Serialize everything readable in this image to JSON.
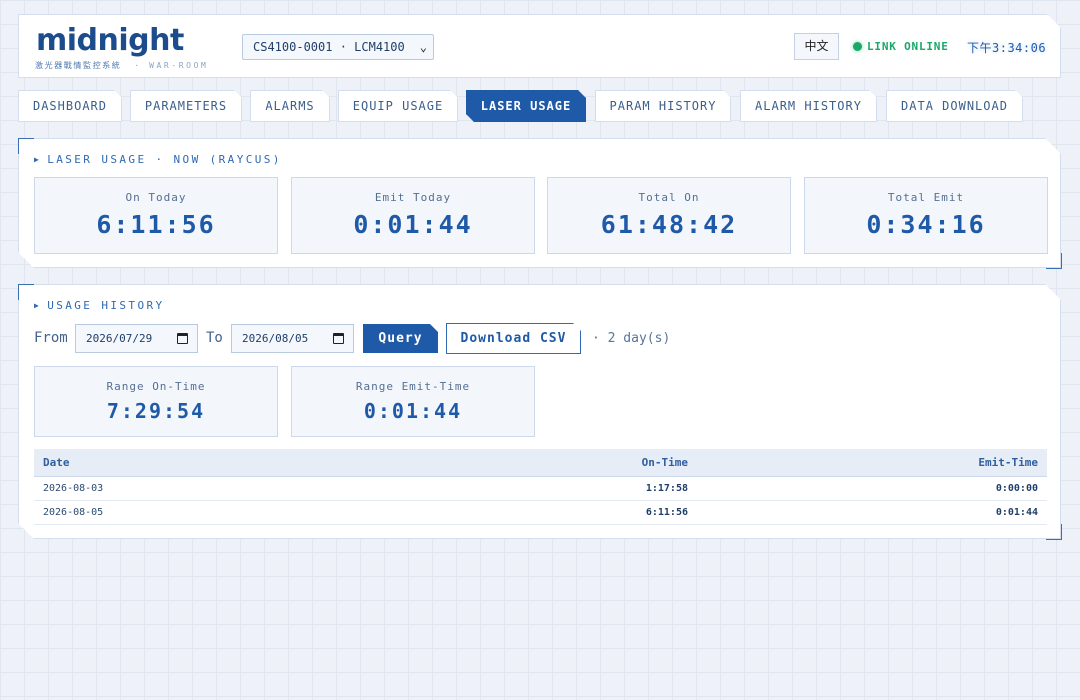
{
  "header": {
    "logo": "midnight",
    "subtitle": "激光器戰情監控系統",
    "subtitle_tag": "· WAR-ROOM",
    "device_select": "CS4100-0001 · LCM4100",
    "lang_button": "中文",
    "link_status": "LINK ONLINE",
    "clock": "下午3:34:06",
    "colors": {
      "brand": "#1c4c8c",
      "online": "#19a86a",
      "accent": "#1f5aa8"
    }
  },
  "tabs": [
    {
      "label": "DASHBOARD",
      "active": false
    },
    {
      "label": "PARAMETERS",
      "active": false
    },
    {
      "label": "ALARMS",
      "active": false
    },
    {
      "label": "EQUIP USAGE",
      "active": false
    },
    {
      "label": "LASER USAGE",
      "active": true
    },
    {
      "label": "PARAM HISTORY",
      "active": false
    },
    {
      "label": "ALARM HISTORY",
      "active": false
    },
    {
      "label": "DATA DOWNLOAD",
      "active": false
    }
  ],
  "laser_usage": {
    "title": "LASER USAGE · NOW (RAYCUS)",
    "cards": [
      {
        "label": "On Today",
        "value": "6:11:56"
      },
      {
        "label": "Emit Today",
        "value": "0:01:44"
      },
      {
        "label": "Total On",
        "value": "61:48:42"
      },
      {
        "label": "Total Emit",
        "value": "0:34:16"
      }
    ]
  },
  "usage_history": {
    "title": "USAGE HISTORY",
    "from_label": "From",
    "from_value": "2026/07/29",
    "to_label": "To",
    "to_value": "2026/08/05",
    "query_button": "Query",
    "csv_button": "Download CSV",
    "days_note": "· 2 day(s)",
    "range_cards": [
      {
        "label": "Range On-Time",
        "value": "7:29:54"
      },
      {
        "label": "Range Emit-Time",
        "value": "0:01:44"
      }
    ],
    "table": {
      "headers": [
        "Date",
        "On-Time",
        "Emit-Time"
      ],
      "rows": [
        [
          "2026-08-03",
          "1:17:58",
          "0:00:00"
        ],
        [
          "2026-08-05",
          "6:11:56",
          "0:01:44"
        ]
      ]
    }
  }
}
